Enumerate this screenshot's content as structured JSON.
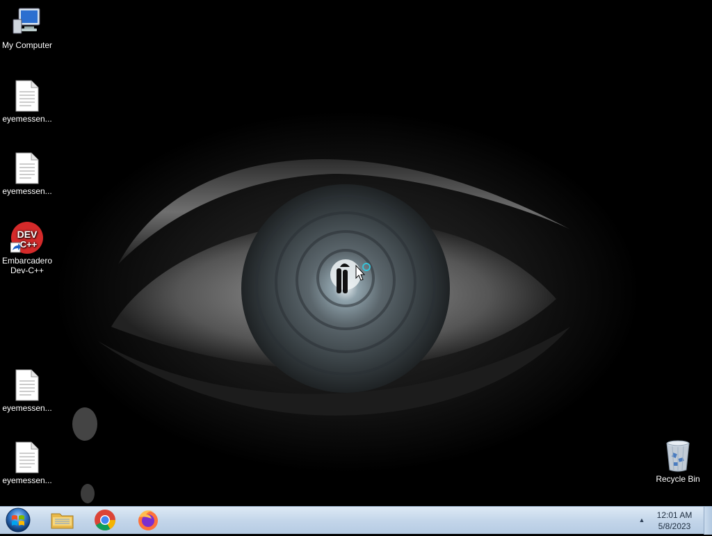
{
  "desktop": {
    "icons": [
      {
        "label": "My Computer",
        "icon": "computer-icon"
      },
      {
        "label": "eyemessen...",
        "icon": "text-file-icon"
      },
      {
        "label": "eyemessen...",
        "icon": "text-file-icon"
      },
      {
        "label": "Embarcadero Dev-C++",
        "icon": "devcpp-shortcut-icon",
        "icon_text": "DEV"
      },
      {
        "label": "eyemessen...",
        "icon": "text-file-icon"
      },
      {
        "label": "eyemessen...",
        "icon": "text-file-icon"
      },
      {
        "label": "Recycle Bin",
        "icon": "recycle-bin-icon"
      }
    ]
  },
  "taskbar": {
    "start": {
      "icon": "windows-start-orb-icon"
    },
    "pinned": [
      {
        "icon": "file-explorer-icon"
      },
      {
        "icon": "chrome-icon"
      },
      {
        "icon": "firefox-icon"
      }
    ],
    "tray": {
      "arrow_icon": "show-hidden-icons-arrow",
      "time": "12:01 AM",
      "date": "5/8/2023"
    }
  },
  "colors": {
    "taskbar_bg": "#c4d6ea",
    "desktop_bg": "#000000",
    "start_orb": "#2a6fbf",
    "devcpp_red": "#d42a2a"
  }
}
